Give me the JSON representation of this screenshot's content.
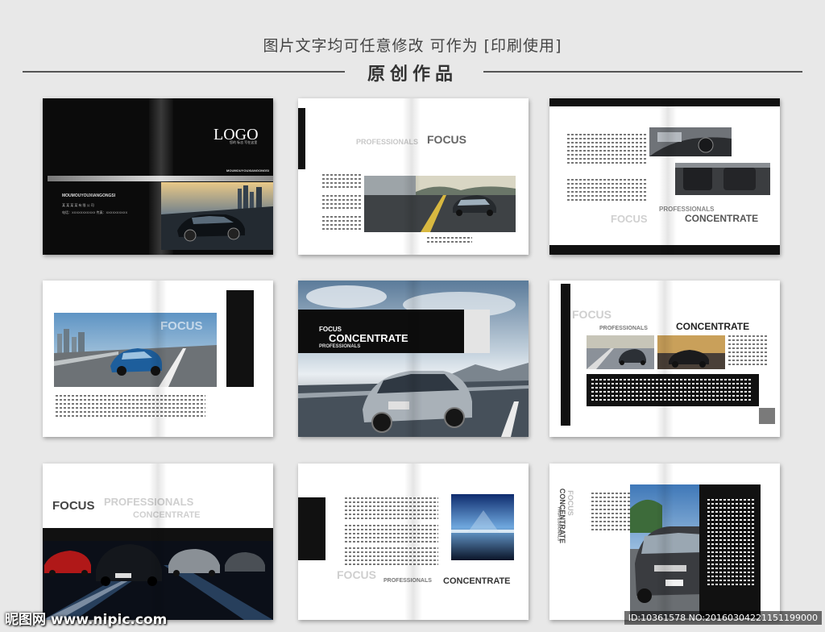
{
  "header": {
    "title": "图片文字均可任意修改 可作为 [印刷使用]",
    "subtitle": "原创作品"
  },
  "spread1": {
    "logo": "LOGO",
    "logo_cn": "您的 标志 写在这里",
    "brand_small": "MOUMOUYOUXIANGONGSI",
    "brand_left": "MOUMOUYOUXIANGONGSI",
    "info_line1": "某 某 某 某 有 限 公 司",
    "info_line2": "电话：XXXXXXXXXXX    传真：XXXXXXXXXX"
  },
  "spread2": {
    "professionals": "PROFESSIONALS",
    "focus": "FOCUS"
  },
  "spread3": {
    "professionals": "PROFESSIONALS",
    "focus": "FOCUS",
    "concentrate": "CONCENTRATE"
  },
  "spread4": {
    "focus": "FOCUS"
  },
  "spread5": {
    "focus": "FOCUS",
    "concentrate": "CONCENTRATE",
    "professionals": "PROFESSIONALS"
  },
  "spread6": {
    "focus": "FOCUS",
    "professionals": "PROFESSIONALS",
    "concentrate": "CONCENTRATE"
  },
  "spread7": {
    "focus": "FOCUS",
    "professionals": "PROFESSIONALS",
    "concentrate": "CONCENTRATE"
  },
  "spread8": {
    "focus": "FOCUS",
    "professionals": "PROFESSIONALS",
    "concentrate": "CONCENTRATE"
  },
  "spread9": {
    "concentrate": "CONCENTRATE",
    "focus": "FOCUS",
    "professionals": "PROFESSIONALS"
  },
  "watermark": {
    "left": "昵图网 www.nipic.com",
    "right": "ID:10361578 NO:20160304221151199000"
  }
}
